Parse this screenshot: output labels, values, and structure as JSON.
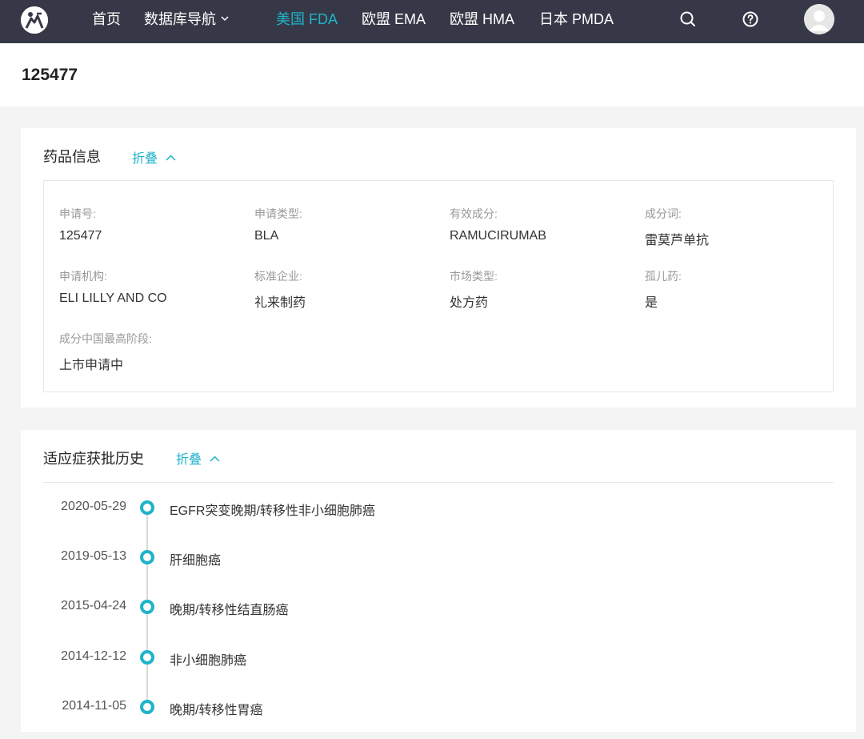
{
  "nav": {
    "home": "首页",
    "db_nav": "数据库导航",
    "fda": "美国 FDA",
    "ema": "欧盟 EMA",
    "hma": "欧盟 HMA",
    "pmda": "日本 PMDA",
    "icons": [
      "logo-icon",
      "search-icon",
      "help-icon",
      "user-avatar-icon"
    ],
    "colors": {
      "bar": "#363847",
      "active": "#1fb3c9"
    }
  },
  "page": {
    "title": "125477"
  },
  "drug_info": {
    "heading": "药品信息",
    "collapse_label": "折叠",
    "fields": [
      {
        "label": "申请号:",
        "value": "125477"
      },
      {
        "label": "申请类型:",
        "value": "BLA"
      },
      {
        "label": "有效成分:",
        "value": "RAMUCIRUMAB"
      },
      {
        "label": "成分词:",
        "value": "雷莫芦单抗"
      },
      {
        "label": "申请机构:",
        "value": "ELI LILLY AND CO"
      },
      {
        "label": "标准企业:",
        "value": "礼来制药"
      },
      {
        "label": "市场类型:",
        "value": "处方药"
      },
      {
        "label": "孤儿药:",
        "value": "是"
      },
      {
        "label": "成分中国最高阶段:",
        "value": "上市申请中"
      }
    ]
  },
  "history": {
    "heading": "适应症获批历史",
    "collapse_label": "折叠",
    "items": [
      {
        "date": "2020-05-29",
        "text": "EGFR突变晚期/转移性非小细胞肺癌"
      },
      {
        "date": "2019-05-13",
        "text": "肝细胞癌"
      },
      {
        "date": "2015-04-24",
        "text": "晚期/转移性结直肠癌"
      },
      {
        "date": "2014-12-12",
        "text": "非小细胞肺癌"
      },
      {
        "date": "2014-11-05",
        "text": "晚期/转移性胃癌"
      }
    ]
  }
}
